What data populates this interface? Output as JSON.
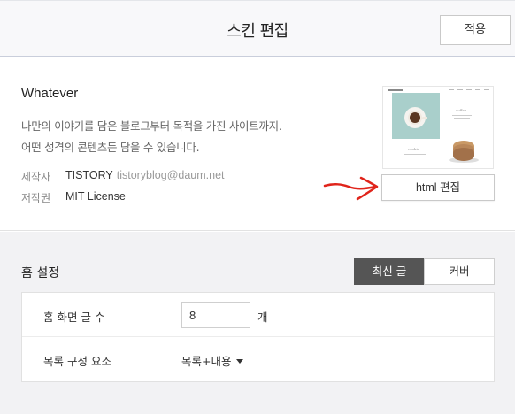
{
  "header": {
    "title": "스킨 편집",
    "apply_label": "적용"
  },
  "skin": {
    "name": "Whatever",
    "description_line1": "나만의 이야기를 담은 블로그부터 목적을 가진 사이트까지.",
    "description_line2": "어떤 성격의 콘텐츠든 담을 수 있습니다.",
    "maker_label": "제작자",
    "maker_name": "TISTORY",
    "maker_email": "tistoryblog@daum.net",
    "license_label": "저작권",
    "license_value": "MIT License",
    "html_edit_label": "html 편집",
    "thumbnail": {
      "coffee_text": "coffee",
      "cookie_text": "cookie"
    }
  },
  "home_settings": {
    "title": "홈 설정",
    "tabs": [
      {
        "label": "최신 글",
        "active": true
      },
      {
        "label": "커버",
        "active": false
      }
    ],
    "post_count_label": "홈 화면 글 수",
    "post_count_value": "8",
    "post_count_unit": "개",
    "list_component_label": "목록 구성 요소",
    "list_component_value": "목록+내용"
  },
  "colors": {
    "active_tab_bg": "#555555",
    "annotation_arrow": "#e0241b",
    "header_border": "#c9cedb"
  }
}
